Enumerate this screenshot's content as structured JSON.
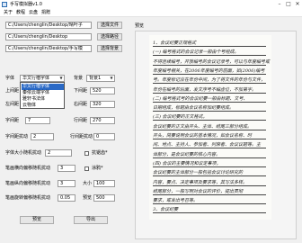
{
  "window": {
    "title": "手写模拟器v1.0"
  },
  "menu": [
    "关于",
    "教程",
    "云盘",
    "捐赠"
  ],
  "paths": [
    {
      "value": "C:/Users/chenglin/Desktop/晴叶子",
      "button": "选择文件"
    },
    {
      "value": "C:/Users/chenglin/Desktop",
      "button": "选择路径"
    },
    {
      "value": "C:/Users/chenglin/Desktop/手写模",
      "button": "选择背景"
    }
  ],
  "preview_label": "预览",
  "font": {
    "label": "字体",
    "value": "华文行楷字体",
    "options": [
      "华文行楷字体",
      "秦侬云端字体",
      "雅轩书法体",
      "云物体"
    ]
  },
  "background": {
    "label": "背景",
    "value": "背景1"
  },
  "margins": {
    "top": {
      "label": "上间距",
      "value": "40"
    },
    "bottom": {
      "label": "下间距",
      "value": "520"
    },
    "left": {
      "label": "左间距",
      "value": "40"
    },
    "right": {
      "label": "右间距",
      "value": "320"
    }
  },
  "spacing": {
    "char": {
      "label": "字间距",
      "value": "7"
    },
    "line": {
      "label": "行间距",
      "value": "270"
    }
  },
  "disturbance": {
    "char_label": "字间距扰动",
    "char_value": "2",
    "line_label": "行间距扰动",
    "line_value": "0"
  },
  "size_disturb": {
    "label": "字体大小随机扰动",
    "value": "2"
  },
  "stroke_h": {
    "label": "笔画横向偏移随机扰动",
    "value": "3"
  },
  "stroke_v": {
    "label": "笔画纵向偏移随机扰动",
    "value": "3"
  },
  "stroke_rot": {
    "label": "笔画旋转偏移随机扰动",
    "value": "0.05"
  },
  "options": {
    "antialias": {
      "label": "抗锯齿*",
      "checked": false
    },
    "strikethrough": {
      "label": "涂鸦*",
      "checked": false
    }
  },
  "size": {
    "label": "大小",
    "value": "100"
  },
  "dpi": {
    "label": "预览",
    "value": "500"
  },
  "buttons": {
    "preview": "预览",
    "export": "导出"
  },
  "paper_lines": [
    "1、会议纪要正规格式",
    "(一)  编号格式的会议记录一般由个号组成。",
    "不得连续编号，开放编号的会议记录号，可以与年度编号或",
    "年度编号相关，在2006年度编号的前面，如(2006)编号",
    "号。年度标记应在年份中间，为了将文件的年份与文件，",
    "年份在编号的后面，发文序号不编虚位，不加第字。",
    "(二) 编号格式号的会议纪要一般由标题、文号、",
    "日期组成，标题由会议名称加纪要组成。",
    "(三)  会议纪要的正文格式，",
    "会议纪要的正文由开头、主体、结尾三部分组成。",
    "开头，简要说明会议的基本情况，如会议名称、时",
    "间、地点、主持人、参加者、列席者、会议议题等。主",
    "体部分，是会议纪要的核心内容。",
    "(四)  会议的主要情况和议定事项，",
    "会议纪要的主体部分一般包括会议讨论研究的",
    "内容，要点、决定事项及要求等，其写法多样。",
    "结尾部分，一般写明对会议的评价，提出贯彻",
    "要求，或发出号召等。",
    "3、会议纪要"
  ]
}
